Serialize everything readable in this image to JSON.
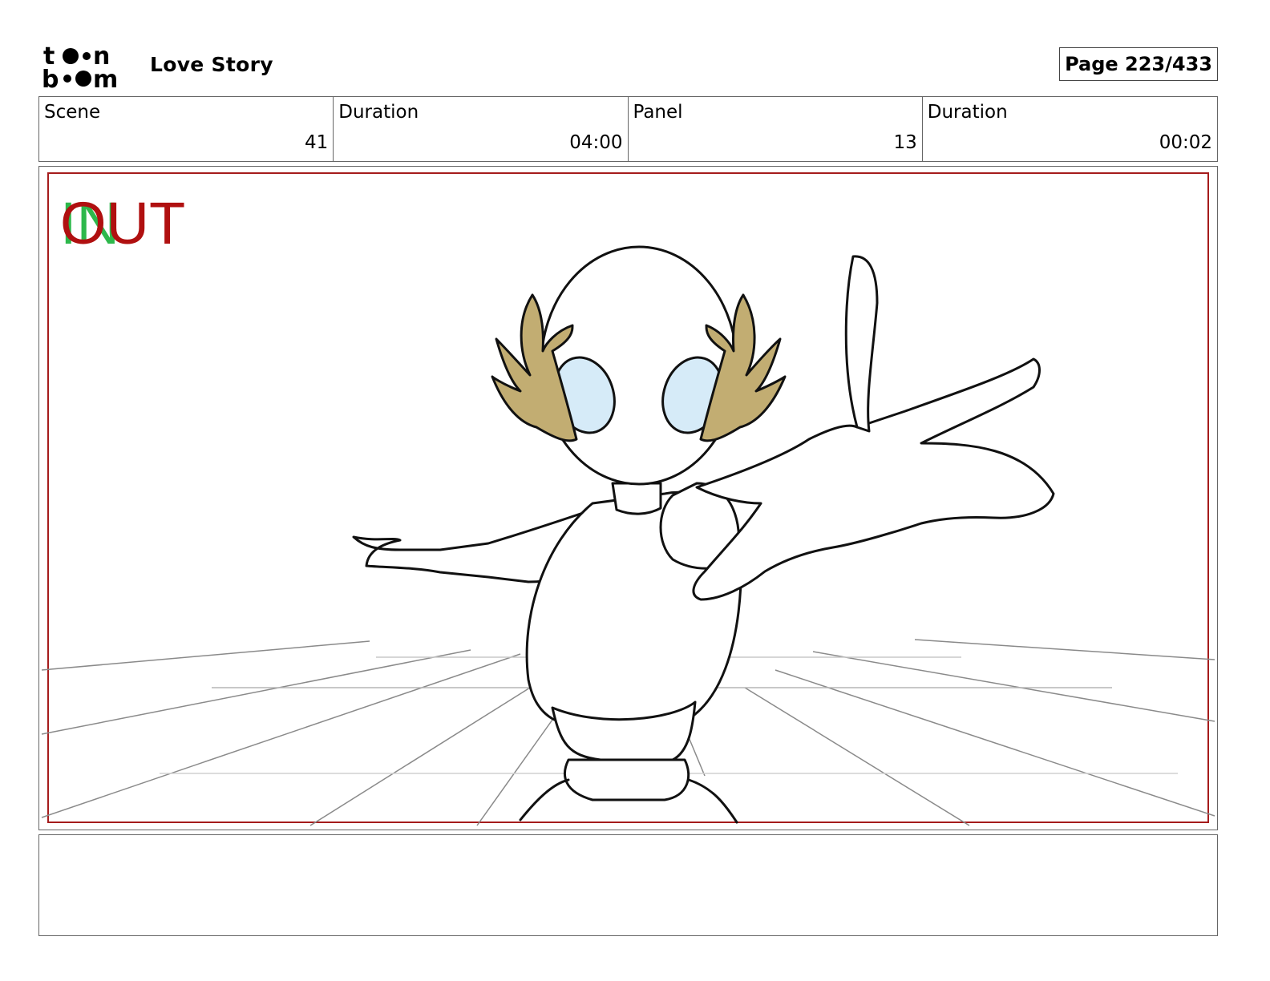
{
  "header": {
    "logo_top": "toon",
    "logo_bottom": "boom",
    "project_title": "Love Story",
    "page_label": "Page 223/433"
  },
  "info": [
    {
      "label": "Scene",
      "value": "41"
    },
    {
      "label": "Duration",
      "value": "04:00"
    },
    {
      "label": "Panel",
      "value": "13"
    },
    {
      "label": "Duration",
      "value": "00:02"
    }
  ],
  "panel": {
    "marker_in": "IN",
    "marker_out": "OUT",
    "colors": {
      "safe_frame": "#a51c1c",
      "in_marker": "#2db84b",
      "out_marker": "#b01010",
      "leaves": "#c2ad72",
      "eyes": "#d6ebf8",
      "grid": "#8a8a8a"
    }
  },
  "notes": {
    "text": ""
  }
}
